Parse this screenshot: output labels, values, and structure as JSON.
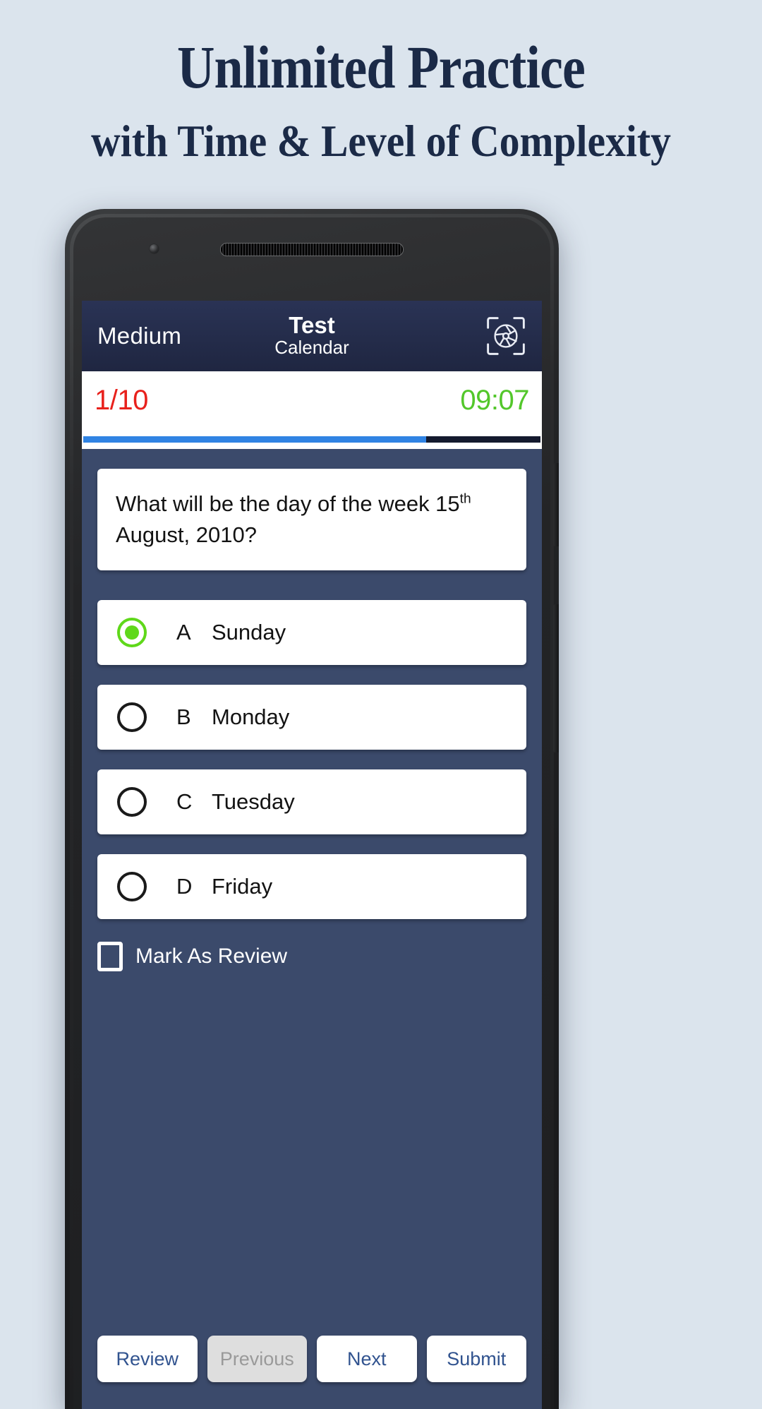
{
  "promo": {
    "title": "Unlimited Practice",
    "subtitle": "with Time & Level of Complexity"
  },
  "app": {
    "header": {
      "level": "Medium",
      "title": "Test",
      "subject": "Calendar",
      "right_icon": "aperture-scan-icon"
    },
    "status": {
      "question_counter": "1/10",
      "timer": "09:07",
      "counter_color": "#e8211c",
      "timer_color": "#53c72b",
      "progress_percent": 75,
      "progress_color": "#3083e3"
    },
    "question": {
      "text_before": "What will be the day of the week 15",
      "superscript": "th",
      "text_after": " August, 2010?"
    },
    "options": [
      {
        "letter": "A",
        "text": "Sunday",
        "selected": true
      },
      {
        "letter": "B",
        "text": "Monday",
        "selected": false
      },
      {
        "letter": "C",
        "text": "Tuesday",
        "selected": false
      },
      {
        "letter": "D",
        "text": "Friday",
        "selected": false
      }
    ],
    "mark_review": {
      "label": "Mark As Review",
      "checked": false
    },
    "buttons": [
      {
        "label": "Review",
        "disabled": false
      },
      {
        "label": "Previous",
        "disabled": true
      },
      {
        "label": "Next",
        "disabled": false
      },
      {
        "label": "Submit",
        "disabled": false
      }
    ],
    "colors": {
      "header_bg": "#1f2641",
      "body_bg": "#3b4a6b",
      "accent_green": "#5fd81a",
      "button_text": "#31538f"
    }
  }
}
